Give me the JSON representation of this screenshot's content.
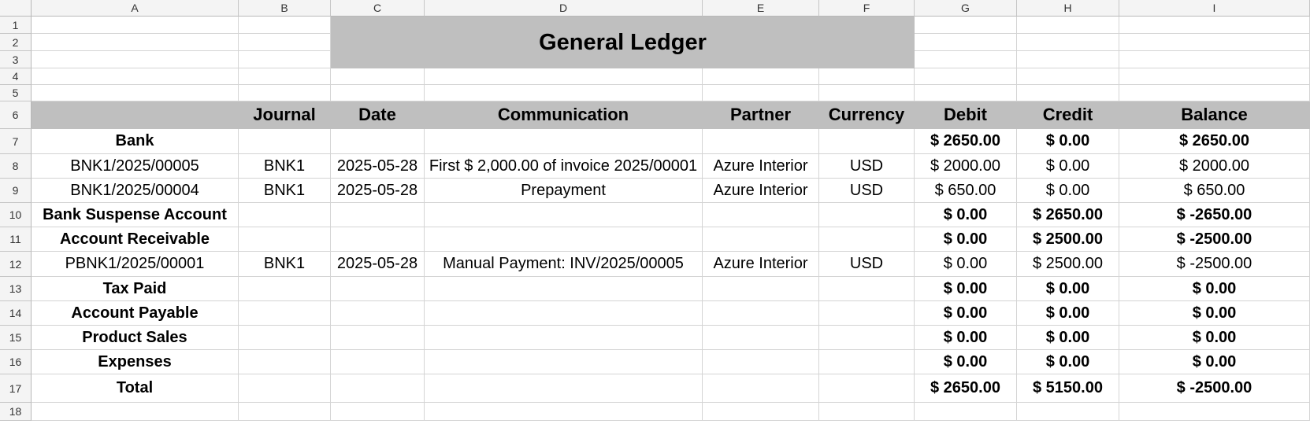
{
  "columns": [
    "A",
    "B",
    "C",
    "D",
    "E",
    "F",
    "G",
    "H",
    "I"
  ],
  "rows": [
    "1",
    "2",
    "3",
    "4",
    "5",
    "6",
    "7",
    "8",
    "9",
    "10",
    "11",
    "12",
    "13",
    "14",
    "15",
    "16",
    "17",
    "18"
  ],
  "title": "General Ledger",
  "headers": [
    "",
    "Journal",
    "Date",
    "Communication",
    "Partner",
    "Currency",
    "Debit",
    "Credit",
    "Balance"
  ],
  "ledger": [
    {
      "bold": true,
      "cells": [
        "Bank",
        "",
        "",
        "",
        "",
        "",
        "$ 2650.00",
        "$ 0.00",
        "$ 2650.00"
      ]
    },
    {
      "bold": false,
      "cells": [
        "BNK1/2025/00005",
        "BNK1",
        "2025-05-28",
        "First $ 2,000.00 of invoice 2025/00001",
        "Azure Interior",
        "USD",
        "$ 2000.00",
        "$ 0.00",
        "$ 2000.00"
      ]
    },
    {
      "bold": false,
      "cells": [
        "BNK1/2025/00004",
        "BNK1",
        "2025-05-28",
        "Prepayment",
        "Azure Interior",
        "USD",
        "$ 650.00",
        "$ 0.00",
        "$ 650.00"
      ]
    },
    {
      "bold": true,
      "cells": [
        "Bank Suspense Account",
        "",
        "",
        "",
        "",
        "",
        "$ 0.00",
        "$ 2650.00",
        "$ -2650.00"
      ]
    },
    {
      "bold": true,
      "cells": [
        "Account Receivable",
        "",
        "",
        "",
        "",
        "",
        "$ 0.00",
        "$ 2500.00",
        "$ -2500.00"
      ]
    },
    {
      "bold": false,
      "cells": [
        "PBNK1/2025/00001",
        "BNK1",
        "2025-05-28",
        "Manual Payment: INV/2025/00005",
        "Azure Interior",
        "USD",
        "$ 0.00",
        "$ 2500.00",
        "$ -2500.00"
      ]
    },
    {
      "bold": true,
      "cells": [
        "Tax Paid",
        "",
        "",
        "",
        "",
        "",
        "$ 0.00",
        "$ 0.00",
        "$ 0.00"
      ]
    },
    {
      "bold": true,
      "cells": [
        "Account Payable",
        "",
        "",
        "",
        "",
        "",
        "$ 0.00",
        "$ 0.00",
        "$ 0.00"
      ]
    },
    {
      "bold": true,
      "cells": [
        "Product Sales",
        "",
        "",
        "",
        "",
        "",
        "$ 0.00",
        "$ 0.00",
        "$ 0.00"
      ]
    },
    {
      "bold": true,
      "cells": [
        "Expenses",
        "",
        "",
        "",
        "",
        "",
        "$ 0.00",
        "$ 0.00",
        "$ 0.00"
      ]
    },
    {
      "bold": true,
      "cells": [
        "Total",
        "",
        "",
        "",
        "",
        "",
        "$ 2650.00",
        "$ 5150.00",
        "$ -2500.00"
      ]
    }
  ]
}
